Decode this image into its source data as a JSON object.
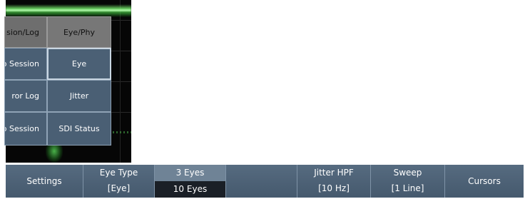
{
  "menu": {
    "col1": {
      "header": "sion/Log",
      "items": [
        "o Session",
        "ror Log",
        "o Session"
      ]
    },
    "col2": {
      "header": "Eye/Phy",
      "items": [
        "Eye",
        "Jitter",
        "SDI Status"
      ]
    }
  },
  "toolbar": {
    "settings": "Settings",
    "eye_type": {
      "label": "Eye Type",
      "value": "[Eye]"
    },
    "eyes": {
      "option_a": "3 Eyes",
      "option_b": "10 Eyes"
    },
    "empty": "",
    "jitter_hpf": {
      "label": "Jitter HPF",
      "value": "[10 Hz]"
    },
    "sweep": {
      "label": "Sweep",
      "value": "[1 Line]"
    },
    "cursors": "Cursors"
  },
  "colors": {
    "panel": "#4a5f74",
    "header_gray": "#6e6e6e",
    "trace_green": "#7ef070",
    "selected_dark": "#1a1f26"
  }
}
